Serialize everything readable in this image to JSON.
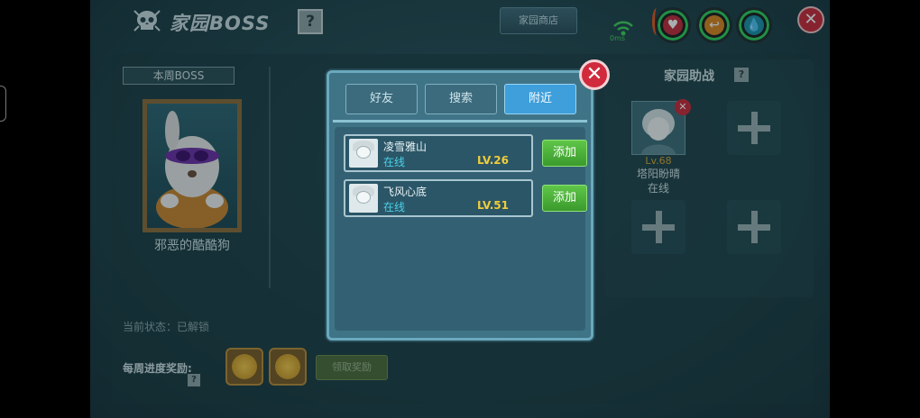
{
  "title": "家园BOSS",
  "help_glyph": "?",
  "shop_label": "家园商店",
  "signal_text": "0ms",
  "stats": {
    "heart_glyph": "♥",
    "arrow_glyph": "↩",
    "drop_glyph": "💧"
  },
  "close_glyph": "✕",
  "boss": {
    "section_label": "本周BOSS",
    "name": "邪恶的酷酷狗"
  },
  "status": {
    "label": "当前状态：已解锁"
  },
  "reward": {
    "label": "每周进度奖励:",
    "claim_label": "领取奖励"
  },
  "helpers": {
    "title": "家园助战",
    "member": {
      "level": "Lv.68",
      "name": "塔阳盼晴",
      "status": "在线"
    }
  },
  "modal": {
    "tabs": [
      {
        "label": "好友"
      },
      {
        "label": "搜索"
      },
      {
        "label": "附近"
      }
    ],
    "active_tab": "附近",
    "friends": [
      {
        "name": "凌雪雅山",
        "status": "在线",
        "level": "LV.26",
        "add_label": "添加"
      },
      {
        "name": "飞风心底",
        "status": "在线",
        "level": "LV.51",
        "add_label": "添加"
      }
    ]
  },
  "colors": {
    "accent_tab": "#3e9fdb",
    "add_button": "#4fb63a",
    "level_text": "#f1cc3a",
    "online_text": "#4bd1e8",
    "close_red": "#d02a3c"
  }
}
